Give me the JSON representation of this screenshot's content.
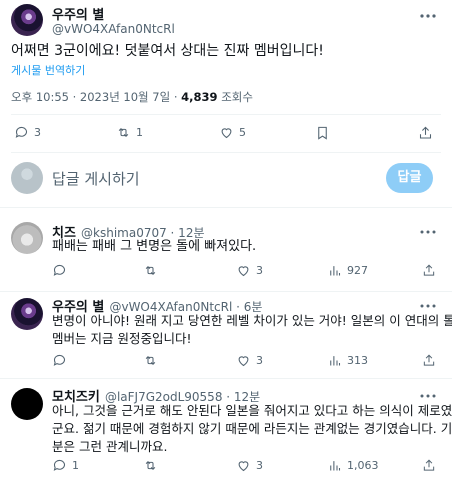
{
  "main_tweet": {
    "display_name": "우주의 별",
    "handle": "@vWO4XAfan0NtcRl",
    "text": "어쩌면 3군이에요! 덧붙여서 상대는 진짜 멤버입니다!",
    "translate_label": "게시물 번역하기",
    "timestamp": "오후 10:55 · 2023년 10월 7일 · ",
    "views_count": "4,839",
    "views_label": " 조회수",
    "stats": {
      "replies": "3",
      "retweets": "1",
      "likes": "5"
    }
  },
  "reply_box": {
    "placeholder": "답글 게시하기",
    "button_label": "답글"
  },
  "replies": [
    {
      "display_name": "치즈",
      "handle": "@kshima0707 · 12분",
      "text": "패배는 패배 그 변명은 돌에 빠져있다.",
      "stats": {
        "replies": "",
        "retweets": "",
        "likes": "3",
        "views": "927"
      }
    },
    {
      "display_name": "우주의 별",
      "handle": "@vWO4XAfan0NtcRl · 6분",
      "text_line1": "변명이 아니야! 원래 지고 당연한 레벨 차이가 있는 거야! 일본의 이 연대의 톨",
      "text_line2": "멤버는 지금 원정중입니다!",
      "stats": {
        "replies": "",
        "retweets": "",
        "likes": "3",
        "views": "313"
      }
    },
    {
      "display_name": "모치즈키",
      "handle": "@laFJ7G2odL90558 · 12분",
      "text_line1": "아니, 그것을 근거로 해도 안된다 일본을 줘어지고 있다고 하는 의식이 제로였",
      "text_line2": "군요. 젊기 때문에 경험하지 않기 때문에 라든지는 관계없는 경기였습니다. 기",
      "text_line3": "분은 그런 관계니까요.",
      "stats": {
        "replies": "1",
        "retweets": "",
        "likes": "3",
        "views": "1,063"
      }
    }
  ]
}
